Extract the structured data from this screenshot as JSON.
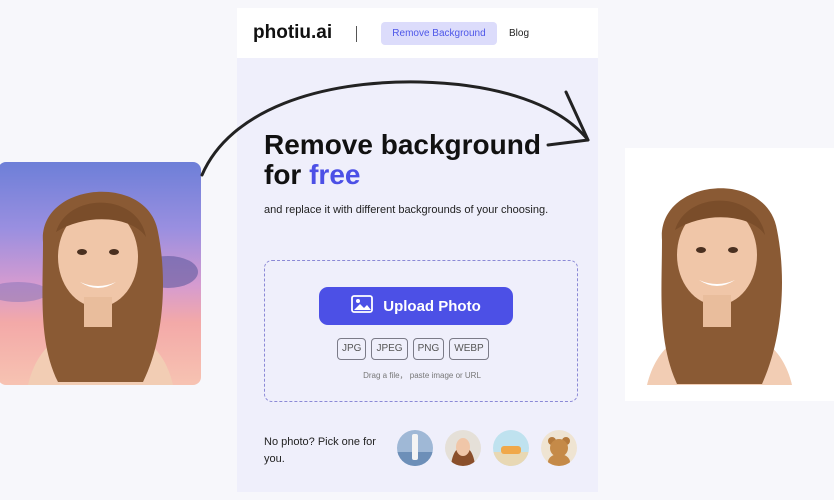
{
  "app": {
    "logo": "photiu.ai",
    "nav": {
      "remove_background": "Remove Background",
      "blog": "Blog"
    }
  },
  "hero": {
    "headline_line1": "Remove background",
    "headline_for": "for",
    "headline_accent": "free",
    "subtitle": "and replace it with different backgrounds of your choosing."
  },
  "upload": {
    "button_label": "Upload Photo",
    "formats": [
      "JPG",
      "JPEG",
      "PNG",
      "WEBP"
    ],
    "hint": "Drag a file， paste image or URL"
  },
  "samples": {
    "prompt": "No photo? Pick one for you.",
    "items": [
      {
        "name": "bottle-sample",
        "bg": "#9fb8d6"
      },
      {
        "name": "woman-sample",
        "bg": "#e5e0d8"
      },
      {
        "name": "car-beach-sample",
        "bg": "#bfe2ef"
      },
      {
        "name": "teddy-bear-sample",
        "bg": "#efe4d2"
      }
    ]
  },
  "colors": {
    "accent": "#4c50e6",
    "page_bg": "#efeffb",
    "nav_pill_bg": "#dcdcfb"
  },
  "icons": {
    "upload": "image-icon"
  }
}
